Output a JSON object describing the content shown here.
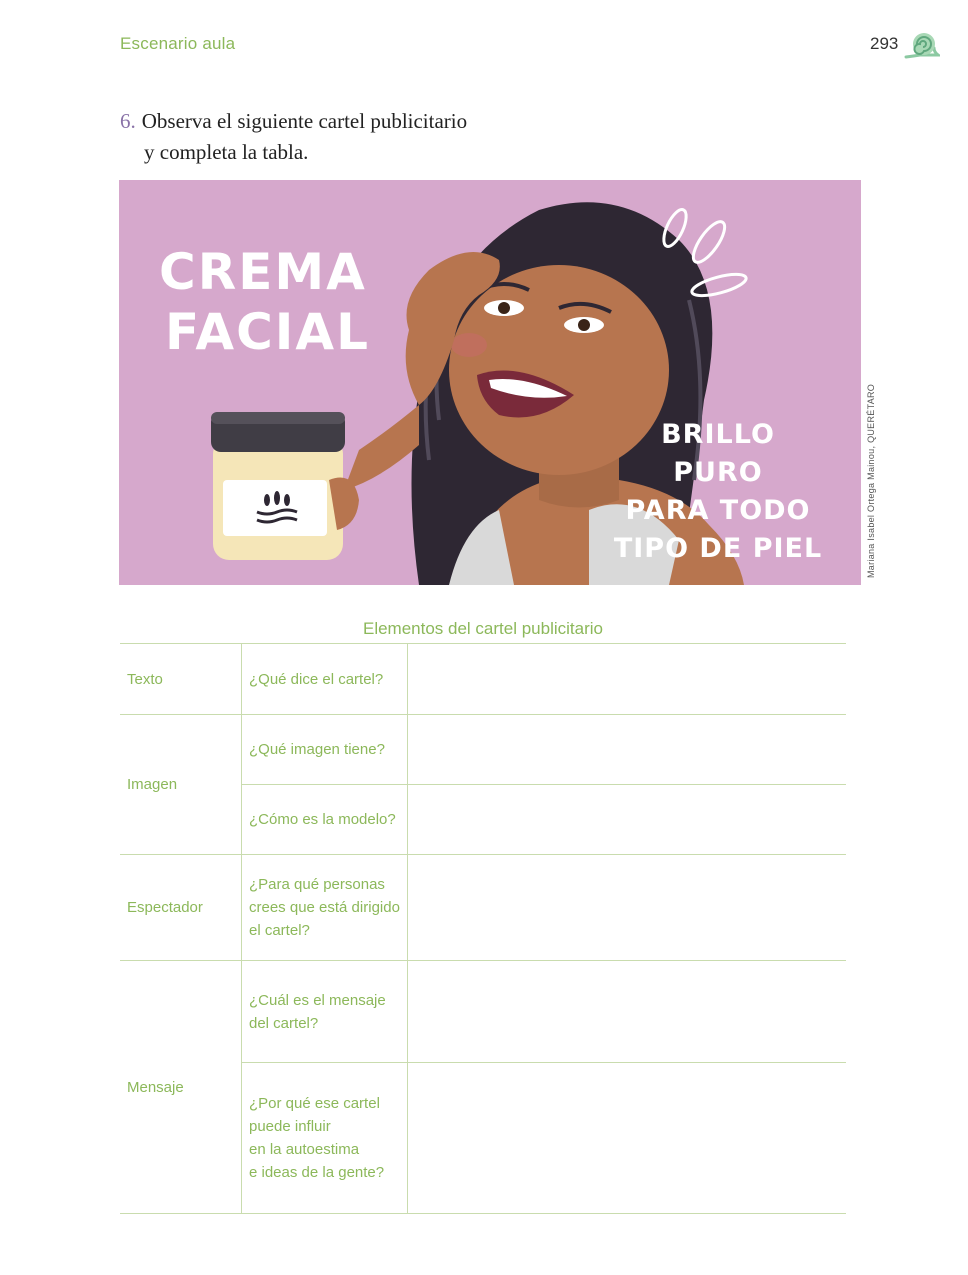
{
  "header": {
    "section_title": "Escenario aula",
    "page_number": "293",
    "logo_icon": "snail-icon"
  },
  "instruction": {
    "number": "6.",
    "line1": "Observa el siguiente cartel publicitario",
    "line2": "y completa la tabla."
  },
  "poster": {
    "title_line1": "CREMA",
    "title_line2": "FACIAL",
    "slogan_lines": [
      "BRILLO",
      "PURO",
      "PARA TODO",
      "TIPO DE PIEL"
    ],
    "credit": "Mariana Isabel Ortega Mainou, QUERÉTARO",
    "colors": {
      "background": "#d6a8cc",
      "skin": "#b7754f",
      "hair": "#2e2733",
      "jar_lid": "#403d45",
      "jar_body": "#f5e6b8"
    }
  },
  "table": {
    "caption": "Elementos del cartel publicitario",
    "rows": [
      {
        "category": "Texto",
        "question_lines": [
          "¿Qué dice el cartel?"
        ],
        "answer": ""
      },
      {
        "category": "Imagen",
        "question_lines": [
          "¿Qué imagen tiene?"
        ],
        "answer": ""
      },
      {
        "category": "",
        "question_lines": [
          "¿Cómo es la modelo?"
        ],
        "answer": ""
      },
      {
        "category": "Espectador",
        "question_lines": [
          "¿Para qué personas",
          "crees que está dirigido",
          "el cartel?"
        ],
        "answer": ""
      },
      {
        "category": "Mensaje",
        "question_lines": [
          "¿Cuál es el mensaje",
          "del cartel?"
        ],
        "answer": ""
      },
      {
        "category": "",
        "question_lines": [
          "¿Por qué ese cartel",
          "puede influir",
          "en la autoestima",
          "e ideas de la gente?"
        ],
        "answer": ""
      }
    ]
  }
}
